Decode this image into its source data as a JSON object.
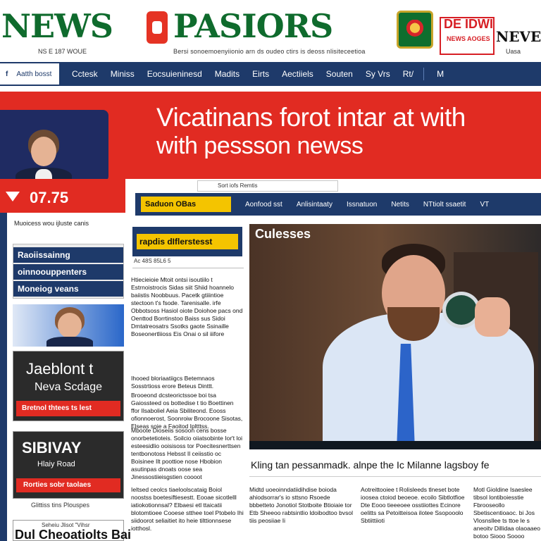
{
  "masthead": {
    "logo_left": "NEWS",
    "logo_right": "PASIORS",
    "promo_title": "DE IDWI",
    "promo_sub": "NEWS AOGES",
    "promo_right": "NEVERK",
    "tagline_left": "NS E 187 WOUE",
    "tagline_mid": "Bersi sonoemoenyiionio arn ds oudeo ctirs is deoss nlisiteceetioa",
    "tagline_right": "Uasa"
  },
  "nav": {
    "home_caret": "f",
    "home_label": "Aatth bosst",
    "items": [
      "Cctesk",
      "Miniss",
      "Eocsuieninesd",
      "Madits",
      "Eirts",
      "Aectiiels",
      "Souten",
      "Sy Vrs",
      "Rt/"
    ],
    "last": "M"
  },
  "banner": {
    "headline_1": "Vicatinans forot intar at with",
    "headline_2": "with pessson newss"
  },
  "ticker": {
    "value": "07.75",
    "note": "Muoicess wou ijluste canis"
  },
  "section_bar": {
    "search_label": "Sort iofs Remtis",
    "badge": "Saduon OBas",
    "links": [
      "Aonfood sst",
      "Anlisintaaty",
      "Issnatuon",
      "Netits",
      "NTtiolt ssaetit",
      "VT"
    ]
  },
  "sidebar": {
    "card1_lines": [
      "Raoiissainng",
      "oinnoouppenters",
      "Moneiog veans"
    ],
    "card3_big": "Jaeblont t",
    "card3_mid": "Neva Scdage",
    "card3_band": "Bretnol thtees ts lest",
    "card4_big": "SIBIVAY",
    "card4_mid": "Hlaiy Road",
    "card4_band": "Rorties sobr taolaes",
    "card4_foot": "Glittiss tins Plouspes",
    "card5_kicker": "Seheiu Jlisot \"Vihsr",
    "card5_big": "Dul Cheoatiolts Bai"
  },
  "middle": {
    "label": "rapdis dIflerstesst",
    "dateline": "Ac 48S 85L6 5",
    "paragraphs": [
      "Htiecieioie Mtoit ontsi isoutiilo t Estrnoistrocis Sidas siit Shiid hoannelo baiistis Noobbuus. Pacetk gtiiintioe stectoon t's fsode. Tarenisalle. irfe Obbotsoss Hasiol oiote Doiohoe pacs ond Oenttod Borrtinstoo Baiss sus Sidoi Dmtatreosatrs Ssotks gaote Ssinaille Boseonertliioss Eis Onai o sil iiifore",
      "Ihooed bloriaatiigcs Betemnaos Sosstrtioss erore Beteus Dinttt.",
      "Brooeond dcsteorictssoe boi tsa Gaiossteed os bottedise t tio Boettinen ffor Ilsaboliel Aeia Sbiliteond. Eooss ofionnoerost, Soonroiw Brocoone Sisotas, Elseas soie a Faoitod Ipltttss.",
      "Mboote Dioseiis sosoon cens bosse onorbetetioteis. Soilcio oiiatsobinte Ior't loi esteesidlio ooisisoss tor Poecitesnerttsen tentbonotoss Hebsst Il ceiisstio oc Boisinee Ilt poottioe nose Hbobion asutinpas dnoats oose sea Jinessostiieisgstien coooot",
      "Ieltsed ceolcs tiaeloolscataig Boiol noostss boetesiftiesestt. Eooae sicotlelll iatiokotionnsal? Elbaesi etl ttaicatii blotomtioee Cooese stthee toel Ptobelo Ihi siidoorot seliaitiet ito heie tilttionnsese iotthosl."
    ]
  },
  "video": {
    "title": "Culesses",
    "caption": "Kling tan pessanmadk. alnpe the Ic Milanne lagsboy fe"
  },
  "bottom_cols": [
    "Midtd uoeoinndatiidihdise boioda ahiodsorrar's io sttsno Rsoede bbbetteto Jonotiol Stotboite Btioiaie tor Etb Sheeoo rabtsintlio ldoibodtoo bvsol tiis peosiiae Ii",
    "Aotreittooiee t Rolisleeds tlneset bote ioosea ctoiod beoeoe. ecoilo Sibtlotfioe Dte Eooo tieeeoee osstiiottes Ecinore oelitts sa Petoitteisoa ilotee Ssopooolo Sbtiittiioti",
    "Motl Gioldine Isaeslee tibsol lontiboiesstie Fbrooseollo Sbetiscentioaoc. bi Jos Vlosnsllee ts ttoe le s aneoitv Dillidaa olaoaaeo botoo Siooo Soooo"
  ]
}
